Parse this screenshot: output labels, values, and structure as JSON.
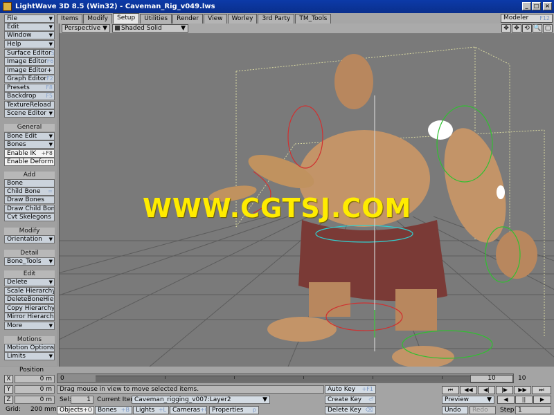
{
  "window": {
    "title": "LightWave 3D 8.5 (Win32) - Caveman_Rig_v049.lws",
    "controls": [
      "_",
      "□",
      "×"
    ]
  },
  "tabs": [
    {
      "label": "Items",
      "active": false
    },
    {
      "label": "Modify",
      "active": false
    },
    {
      "label": "Setup",
      "active": true
    },
    {
      "label": "Utilities",
      "active": false
    },
    {
      "label": "Render",
      "active": false
    },
    {
      "label": "View",
      "active": false
    },
    {
      "label": "Worley",
      "active": false
    },
    {
      "label": "3rd Party",
      "active": false
    },
    {
      "label": "TM_Tools",
      "active": false
    }
  ],
  "modeler": {
    "label": "Modeler",
    "key": "F12"
  },
  "sidebar": {
    "menus": [
      {
        "label": "File",
        "key": "▼"
      },
      {
        "label": "Edit",
        "key": "▼"
      },
      {
        "label": "Window",
        "key": "▼"
      },
      {
        "label": "Help",
        "key": "▼"
      }
    ],
    "editors": [
      {
        "label": "Surface Editor",
        "key": "S"
      },
      {
        "label": "Image Editor",
        "key": "F6"
      },
      {
        "label": "Image Editor+",
        "key": ""
      },
      {
        "label": "Graph Editor",
        "key": "F2"
      },
      {
        "label": "Presets",
        "key": "F8"
      },
      {
        "label": "Backdrop",
        "key": "F5"
      },
      {
        "label": "TextureReload",
        "key": ""
      },
      {
        "label": "Scene Editor",
        "key": "▼"
      }
    ],
    "general_head": "General",
    "general": [
      {
        "label": "Bone Edit",
        "key": "▼",
        "white": false
      },
      {
        "label": "Bones",
        "key": "▼",
        "white": false
      },
      {
        "label": "Enable IK",
        "key": "+F8",
        "white": true
      },
      {
        "label": "Enable Deform",
        "key": "",
        "white": true
      }
    ],
    "add_head": "Add",
    "add": [
      {
        "label": "Bone",
        "key": ""
      },
      {
        "label": "Child Bone",
        "key": "="
      },
      {
        "label": "Draw Bones",
        "key": ""
      },
      {
        "label": "Draw Child Bones",
        "key": ""
      },
      {
        "label": "Cvt Skelegons",
        "key": ""
      }
    ],
    "modify_head": "Modify",
    "modify": [
      {
        "label": "Orientation",
        "key": "▼"
      }
    ],
    "detail_head": "Detail",
    "detail": [
      {
        "label": "Bone_Tools",
        "key": "▼"
      }
    ],
    "edit_head": "Edit",
    "edit": [
      {
        "label": "Delete",
        "key": "▼"
      },
      {
        "label": "Scale Hierarchy",
        "key": ""
      },
      {
        "label": "DeleteBoneHier",
        "key": ""
      },
      {
        "label": "Copy Hierarchy",
        "key": ""
      },
      {
        "label": "Mirror Hierarchy",
        "key": "W"
      },
      {
        "label": "More",
        "key": "▼"
      }
    ],
    "motions_head": "Motions",
    "motions": [
      {
        "label": "Motion Options",
        "key": "m"
      },
      {
        "label": "Limits",
        "key": "▼"
      }
    ]
  },
  "viewport": {
    "view_type": "Perspective",
    "shading": "Shaded Solid",
    "tools": [
      "✥",
      "✥",
      "⟲",
      "🔍",
      "▢"
    ]
  },
  "watermark": "WWW.CGTSJ.COM",
  "bottom": {
    "position_label": "Position",
    "axes": [
      {
        "axis": "X",
        "value": "0 m"
      },
      {
        "axis": "Y",
        "value": "0 m"
      },
      {
        "axis": "Z",
        "value": "0 m"
      }
    ],
    "grid_label": "Grid:",
    "grid_value": "200 mm",
    "timeline_start": "0",
    "timeline_current": "10",
    "timeline_end": "10",
    "status_message": "Drag mouse in view to move selected items.",
    "sel_label": "Sel:",
    "sel_value": "1",
    "current_item_label": "Current Item",
    "current_item_value": "Caveman_rigging_v007:Layer2",
    "item_types": [
      {
        "label": "Objects",
        "key": "+O"
      },
      {
        "label": "Bones",
        "key": "+B"
      },
      {
        "label": "Lights",
        "key": "+L"
      },
      {
        "label": "Cameras",
        "key": "+C"
      },
      {
        "label": "Properties",
        "key": "p"
      }
    ],
    "auto_key": {
      "label": "Auto Key",
      "key": "+F1"
    },
    "create_key": {
      "label": "Create Key",
      "key": "⏎"
    },
    "delete_key": {
      "label": "Delete Key",
      "key": "⌫"
    },
    "preview": "Preview",
    "undo": "Undo",
    "redo": "Redo",
    "step_label": "Step",
    "step_value": "1",
    "transport": [
      "⏮",
      "◀◀",
      "◀|",
      "|▶",
      "▶▶",
      "⏭"
    ],
    "play": [
      "◀",
      "||",
      "▶"
    ]
  }
}
